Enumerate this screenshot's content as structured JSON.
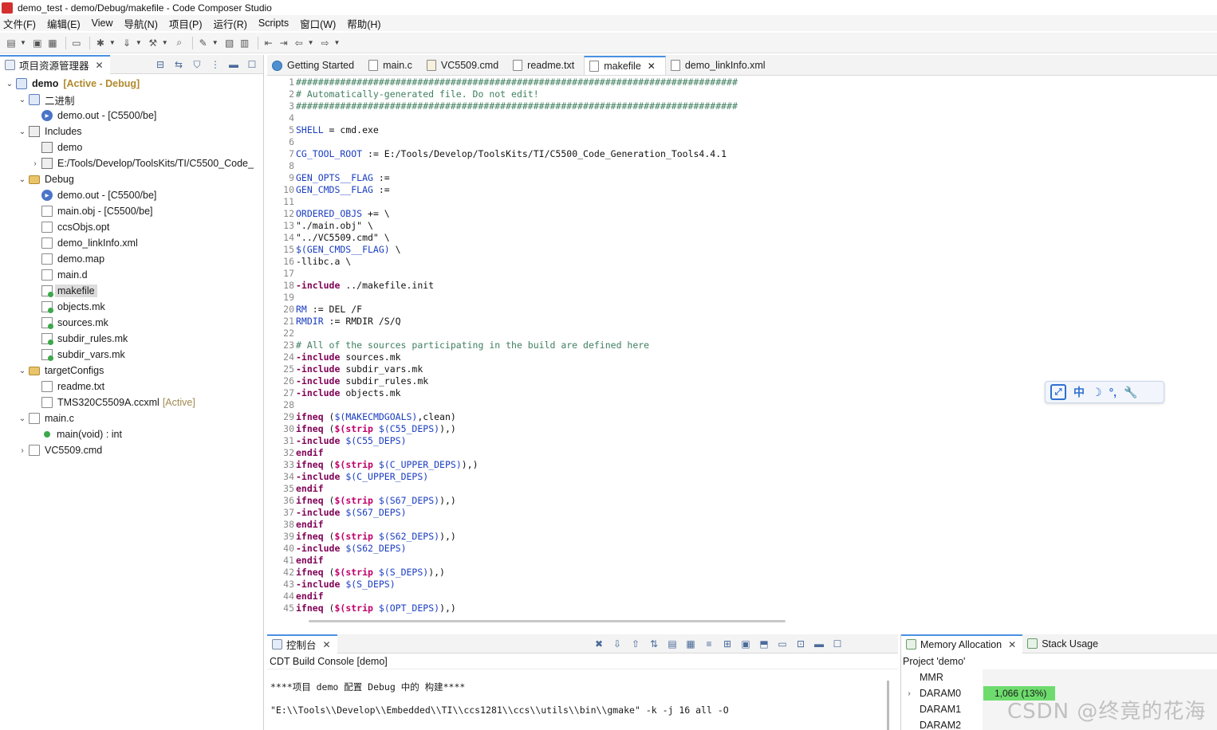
{
  "window": {
    "title": "demo_test - demo/Debug/makefile - Code Composer Studio"
  },
  "menu": [
    "文件(F)",
    "编辑(E)",
    "View",
    "导航(N)",
    "项目(P)",
    "运行(R)",
    "Scripts",
    "窗口(W)",
    "帮助(H)"
  ],
  "left_panel": {
    "tab_label": "项目资源管理器",
    "tree": [
      {
        "indent": 0,
        "chev": "v",
        "icon": "proj",
        "label": "demo",
        "badge": "[Active - Debug]",
        "bold": true
      },
      {
        "indent": 1,
        "chev": "v",
        "icon": "proj",
        "label": "二进制"
      },
      {
        "indent": 2,
        "chev": "",
        "icon": "out",
        "label": "demo.out - [C5500/be]"
      },
      {
        "indent": 1,
        "chev": "v",
        "icon": "inc",
        "label": "Includes"
      },
      {
        "indent": 2,
        "chev": "",
        "icon": "inc",
        "label": "demo"
      },
      {
        "indent": 2,
        "chev": ">",
        "icon": "inc",
        "label": "E:/Tools/Develop/ToolsKits/TI/C5500_Code_"
      },
      {
        "indent": 1,
        "chev": "v",
        "icon": "folder",
        "label": "Debug"
      },
      {
        "indent": 2,
        "chev": "",
        "icon": "out",
        "label": "demo.out - [C5500/be]"
      },
      {
        "indent": 2,
        "chev": "",
        "icon": "file",
        "label": "main.obj - [C5500/be]"
      },
      {
        "indent": 2,
        "chev": "",
        "icon": "file",
        "label": "ccsObjs.opt"
      },
      {
        "indent": 2,
        "chev": "",
        "icon": "file",
        "label": "demo_linkInfo.xml"
      },
      {
        "indent": 2,
        "chev": "",
        "icon": "file",
        "label": "demo.map"
      },
      {
        "indent": 2,
        "chev": "",
        "icon": "file",
        "label": "main.d"
      },
      {
        "indent": 2,
        "chev": "",
        "icon": "mk",
        "label": "makefile",
        "selected": true
      },
      {
        "indent": 2,
        "chev": "",
        "icon": "mk",
        "label": "objects.mk"
      },
      {
        "indent": 2,
        "chev": "",
        "icon": "mk",
        "label": "sources.mk"
      },
      {
        "indent": 2,
        "chev": "",
        "icon": "mk",
        "label": "subdir_rules.mk"
      },
      {
        "indent": 2,
        "chev": "",
        "icon": "mk",
        "label": "subdir_vars.mk"
      },
      {
        "indent": 1,
        "chev": "v",
        "icon": "folder",
        "label": "targetConfigs"
      },
      {
        "indent": 2,
        "chev": "",
        "icon": "file",
        "label": "readme.txt"
      },
      {
        "indent": 2,
        "chev": "",
        "icon": "file",
        "label": "TMS320C5509A.ccxml",
        "dim": "[Active]"
      },
      {
        "indent": 1,
        "chev": "v",
        "icon": "file",
        "label": "main.c"
      },
      {
        "indent": 2,
        "chev": "",
        "icon": "func",
        "label": "main(void) : int"
      },
      {
        "indent": 1,
        "chev": ">",
        "icon": "file",
        "label": "VC5509.cmd"
      }
    ]
  },
  "editor": {
    "tabs": [
      {
        "label": "Getting Started",
        "icon": "gs"
      },
      {
        "label": "main.c",
        "icon": "c"
      },
      {
        "label": "VC5509.cmd",
        "icon": "cmd"
      },
      {
        "label": "readme.txt",
        "icon": "txt"
      },
      {
        "label": "makefile",
        "icon": "mk",
        "active": true
      },
      {
        "label": "demo_linkInfo.xml",
        "icon": "xml"
      }
    ],
    "lines": [
      [
        [
          "cmt",
          "################################################################################"
        ]
      ],
      [
        [
          "cmt",
          "# Automatically-generated file. Do not edit!"
        ]
      ],
      [
        [
          "cmt",
          "################################################################################"
        ]
      ],
      [],
      [
        [
          "var",
          "SHELL"
        ],
        [
          "ct",
          " = cmd.exe"
        ]
      ],
      [],
      [
        [
          "var",
          "CG_TOOL_ROOT"
        ],
        [
          "ct",
          " := E:/Tools/Develop/ToolsKits/TI/C5500_Code_Generation_Tools4.4.1"
        ]
      ],
      [],
      [
        [
          "var",
          "GEN_OPTS__FLAG"
        ],
        [
          "ct",
          " :="
        ]
      ],
      [
        [
          "var",
          "GEN_CMDS__FLAG"
        ],
        [
          "ct",
          " :="
        ]
      ],
      [],
      [
        [
          "var",
          "ORDERED_OBJS"
        ],
        [
          "ct",
          " += \\"
        ]
      ],
      [
        [
          "ct",
          "\"./main.obj\" \\"
        ]
      ],
      [
        [
          "ct",
          "\"../VC5509.cmd\" \\"
        ]
      ],
      [
        [
          "var",
          "$(GEN_CMDS__FLAG)"
        ],
        [
          "ct",
          " \\"
        ]
      ],
      [
        [
          "ct",
          "-llibc.a \\"
        ]
      ],
      [],
      [
        [
          "kw",
          "-include"
        ],
        [
          "ct",
          " ../makefile.init"
        ]
      ],
      [],
      [
        [
          "var",
          "RM"
        ],
        [
          "ct",
          " := DEL /F"
        ]
      ],
      [
        [
          "var",
          "RMDIR"
        ],
        [
          "ct",
          " := RMDIR /S/Q"
        ]
      ],
      [],
      [
        [
          "cmt",
          "# All of the sources participating in the build are defined here"
        ]
      ],
      [
        [
          "kw",
          "-include"
        ],
        [
          "ct",
          " sources.mk"
        ]
      ],
      [
        [
          "kw",
          "-include"
        ],
        [
          "ct",
          " subdir_vars.mk"
        ]
      ],
      [
        [
          "kw",
          "-include"
        ],
        [
          "ct",
          " subdir_rules.mk"
        ]
      ],
      [
        [
          "kw",
          "-include"
        ],
        [
          "ct",
          " objects.mk"
        ]
      ],
      [],
      [
        [
          "kw",
          "ifneq"
        ],
        [
          "ct",
          " ("
        ],
        [
          "var",
          "$(MAKECMDGOALS)"
        ],
        [
          "ct",
          ",clean)"
        ]
      ],
      [
        [
          "kw",
          "ifneq"
        ],
        [
          "ct",
          " ("
        ],
        [
          "fn",
          "$(strip"
        ],
        [
          "ct",
          " "
        ],
        [
          "var",
          "$(C55_DEPS)"
        ],
        [
          "ct",
          "),)"
        ]
      ],
      [
        [
          "kw",
          "-include"
        ],
        [
          "ct",
          " "
        ],
        [
          "var",
          "$(C55_DEPS)"
        ]
      ],
      [
        [
          "kw",
          "endif"
        ]
      ],
      [
        [
          "kw",
          "ifneq"
        ],
        [
          "ct",
          " ("
        ],
        [
          "fn",
          "$(strip"
        ],
        [
          "ct",
          " "
        ],
        [
          "var",
          "$(C_UPPER_DEPS)"
        ],
        [
          "ct",
          "),)"
        ]
      ],
      [
        [
          "kw",
          "-include"
        ],
        [
          "ct",
          " "
        ],
        [
          "var",
          "$(C_UPPER_DEPS)"
        ]
      ],
      [
        [
          "kw",
          "endif"
        ]
      ],
      [
        [
          "kw",
          "ifneq"
        ],
        [
          "ct",
          " ("
        ],
        [
          "fn",
          "$(strip"
        ],
        [
          "ct",
          " "
        ],
        [
          "var",
          "$(S67_DEPS)"
        ],
        [
          "ct",
          "),)"
        ]
      ],
      [
        [
          "kw",
          "-include"
        ],
        [
          "ct",
          " "
        ],
        [
          "var",
          "$(S67_DEPS)"
        ]
      ],
      [
        [
          "kw",
          "endif"
        ]
      ],
      [
        [
          "kw",
          "ifneq"
        ],
        [
          "ct",
          " ("
        ],
        [
          "fn",
          "$(strip"
        ],
        [
          "ct",
          " "
        ],
        [
          "var",
          "$(S62_DEPS)"
        ],
        [
          "ct",
          "),)"
        ]
      ],
      [
        [
          "kw",
          "-include"
        ],
        [
          "ct",
          " "
        ],
        [
          "var",
          "$(S62_DEPS)"
        ]
      ],
      [
        [
          "kw",
          "endif"
        ]
      ],
      [
        [
          "kw",
          "ifneq"
        ],
        [
          "ct",
          " ("
        ],
        [
          "fn",
          "$(strip"
        ],
        [
          "ct",
          " "
        ],
        [
          "var",
          "$(S_DEPS)"
        ],
        [
          "ct",
          "),)"
        ]
      ],
      [
        [
          "kw",
          "-include"
        ],
        [
          "ct",
          " "
        ],
        [
          "var",
          "$(S_DEPS)"
        ]
      ],
      [
        [
          "kw",
          "endif"
        ]
      ],
      [
        [
          "kw",
          "ifneq"
        ],
        [
          "ct",
          " ("
        ],
        [
          "fn",
          "$(strip"
        ],
        [
          "ct",
          " "
        ],
        [
          "var",
          "$(OPT_DEPS)"
        ],
        [
          "ct",
          "),)"
        ]
      ]
    ]
  },
  "ime_bar": {
    "items": [
      "中",
      "☽",
      "°,",
      "🔧"
    ]
  },
  "console": {
    "tab_label": "控制台",
    "subtitle": "CDT Build Console [demo]",
    "lines": [
      "****项目 demo 配置 Debug 中的 构建****",
      "\"E:\\\\Tools\\\\Develop\\\\Embedded\\\\TI\\\\ccs1281\\\\ccs\\\\utils\\\\bin\\\\gmake\" -k -j 16 all -O"
    ]
  },
  "memory": {
    "tab_label": "Memory Allocation",
    "tab2_label": "Stack Usage",
    "subtitle": "Project 'demo'",
    "rows": [
      {
        "name": "MMR",
        "chev": ""
      },
      {
        "name": "DARAM0",
        "chev": ">",
        "usage": "1,066 (13%)"
      },
      {
        "name": "DARAM1",
        "chev": ""
      },
      {
        "name": "DARAM2",
        "chev": ""
      }
    ]
  },
  "watermark": "CSDN @终竟的花海"
}
